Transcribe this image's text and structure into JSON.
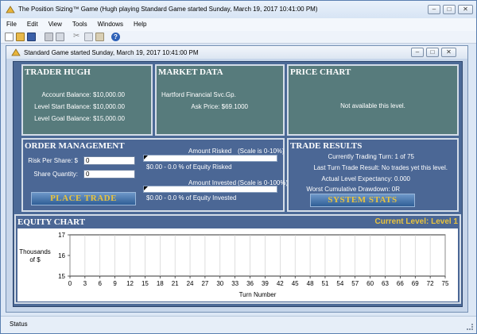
{
  "window": {
    "title": "The Position Sizing™ Game (Hugh playing Standard Game started Sunday, March 19, 2017 10:41:00 PM)"
  },
  "menu": [
    "File",
    "Edit",
    "View",
    "Tools",
    "Windows",
    "Help"
  ],
  "toolbar": {
    "icons": [
      "new-icon",
      "open-icon",
      "save-icon",
      "print-icon",
      "print-preview-icon",
      "cut-icon",
      "copy-icon",
      "paste-icon",
      "help-icon"
    ]
  },
  "child": {
    "title": "Standard Game started Sunday, March 19, 2017 10:41:00 PM"
  },
  "trader": {
    "title": "TRADER HUGH",
    "account_balance": "Account Balance: $10,000.00",
    "level_start": "Level Start Balance: $10,000.00",
    "level_goal": "Level Goal Balance: $15,000.00"
  },
  "market": {
    "title": "MARKET DATA",
    "company": "Hartford Financial Svc.Gp.",
    "ask_price": "Ask Price: $69.1000"
  },
  "price_chart": {
    "title": "PRICE CHART",
    "message": "Not available this level."
  },
  "order": {
    "title": "ORDER MANAGEMENT",
    "risk_label": "Risk Per Share:  $",
    "risk_value": "0",
    "qty_label": "Share Quantity:",
    "qty_value": "0",
    "risked_label": "Amount Risked",
    "risked_scale": "(Scale is 0-10%)",
    "risked_text": "$0.00 - 0.0 % of Equity Risked",
    "risked_fraction": 0,
    "invested_label": "Amount Invested",
    "invested_scale": "(Scale is 0-100%)",
    "invested_text": "$0.00 - 0.0 % of Equity Invested",
    "invested_fraction": 0,
    "place_trade": "PLACE TRADE"
  },
  "results": {
    "title": "TRADE RESULTS",
    "turn": "Currently Trading Turn: 1 of 75",
    "last_turn": "Last Turn Trade Result: No trades yet this level.",
    "expectancy": "Actual Level Expectancy: 0.000",
    "drawdown": "Worst Cumulative Drawdown: 0R",
    "system_stats": "SYSTEM STATS"
  },
  "equity": {
    "title": "EQUITY CHART",
    "level_text": "Current Level:  Level 1"
  },
  "chart_data": {
    "type": "line",
    "title": "",
    "xlabel": "Turn Number",
    "ylabel": "Thousands of $",
    "xlim": [
      0,
      75
    ],
    "ylim": [
      15,
      17
    ],
    "x_ticks": [
      "0",
      "3",
      "6",
      "9",
      "12",
      "15",
      "18",
      "21",
      "24",
      "27",
      "30",
      "33",
      "36",
      "39",
      "42",
      "45",
      "48",
      "51",
      "54",
      "57",
      "60",
      "63",
      "66",
      "69",
      "72",
      "75"
    ],
    "y_ticks": [
      "15",
      "16",
      "17"
    ],
    "grid": true,
    "series": []
  },
  "status": {
    "text": "Status"
  },
  "colors": {
    "panel_teal": "#577b7c",
    "panel_blue": "#4b6795",
    "button_text": "#e9c33d",
    "level_text": "#e9c33d"
  }
}
